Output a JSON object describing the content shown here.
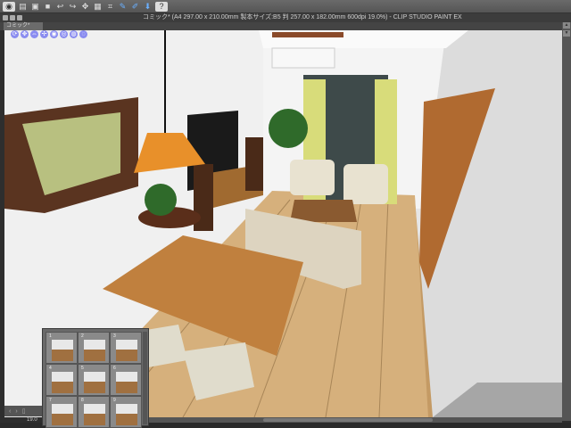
{
  "app": {
    "title": "コミック* (A4 297.00 x 210.00mm 製本サイズ:B5 判 257.00 x 182.00mm 600dpi 19.0%) - CLIP STUDIO PAINT EX"
  },
  "tab": {
    "label": "コミック*"
  },
  "toolbar": {
    "icons": [
      "clip-studio-icon",
      "new-icon",
      "open-icon",
      "save-icon",
      "undo-icon",
      "redo-icon",
      "transform-icon",
      "snap-icon",
      "ruler-icon",
      "help-icon"
    ]
  },
  "nav_icons": [
    "rotate",
    "move",
    "zoom",
    "pan",
    "camera-1",
    "camera-2",
    "camera-3",
    "camera-4"
  ],
  "camera_panel": {
    "items": [
      "1",
      "2",
      "3",
      "4",
      "5",
      "6",
      "7",
      "8",
      "9"
    ]
  },
  "status": {
    "zoom": "19.0"
  },
  "colors": {
    "accent": "#6ab0ff",
    "nav": "#8a8cf0"
  }
}
